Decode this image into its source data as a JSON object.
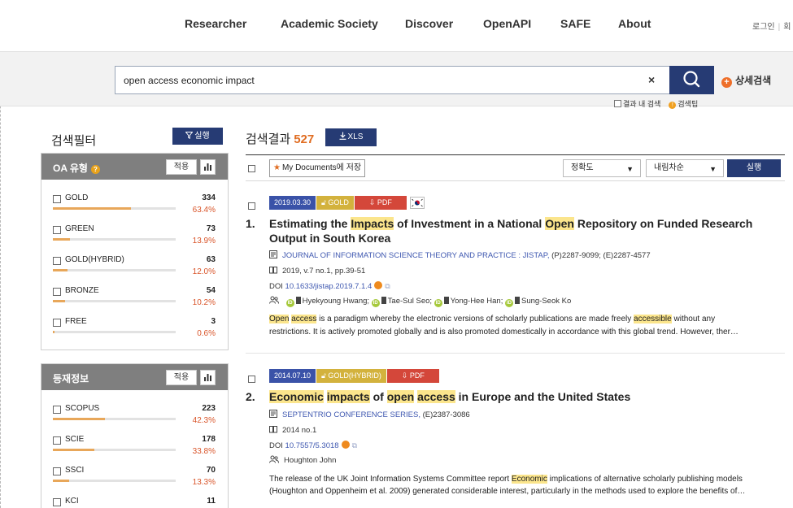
{
  "nav": {
    "items": [
      "Researcher",
      "Academic Society",
      "Discover",
      "OpenAPI",
      "SAFE",
      "About"
    ],
    "login": "로그인",
    "login_sep": "|",
    "login_next": "회"
  },
  "search": {
    "query": "open access economic impact",
    "clear": "×",
    "advanced": "상세검색",
    "within_results": "결과 내 검색",
    "search_tips": "검색팁"
  },
  "filter": {
    "title": "검색필터",
    "run": "실행",
    "apply": "적용",
    "oa_panel": {
      "title": "OA 유형",
      "help": "?",
      "rows": [
        {
          "label": "GOLD",
          "count": "334",
          "pct": "63.4%",
          "fraction": 0.634
        },
        {
          "label": "GREEN",
          "count": "73",
          "pct": "13.9%",
          "fraction": 0.139
        },
        {
          "label": "GOLD(HYBRID)",
          "count": "63",
          "pct": "12.0%",
          "fraction": 0.12
        },
        {
          "label": "BRONZE",
          "count": "54",
          "pct": "10.2%",
          "fraction": 0.102
        },
        {
          "label": "FREE",
          "count": "3",
          "pct": "0.6%",
          "fraction": 0.006
        }
      ]
    },
    "index_panel": {
      "title": "등재정보",
      "rows": [
        {
          "label": "SCOPUS",
          "count": "223",
          "pct": "42.3%",
          "fraction": 0.423
        },
        {
          "label": "SCIE",
          "count": "178",
          "pct": "33.8%",
          "fraction": 0.338
        },
        {
          "label": "SSCI",
          "count": "70",
          "pct": "13.3%",
          "fraction": 0.133
        },
        {
          "label": "KCI",
          "count": "11",
          "pct": "",
          "fraction": 0
        }
      ]
    }
  },
  "results": {
    "title": "검색결과",
    "count": "527",
    "xls": "XLS",
    "save_label": "My Documents에 저장",
    "sort_value": "정확도",
    "order_value": "내림차순",
    "exec": "실행",
    "items": [
      {
        "no": "1.",
        "date": "2019.03.30",
        "oa": "GOLD",
        "pdf": "PDF",
        "title_parts": [
          {
            "t": "Estimating the ",
            "hl": false
          },
          {
            "t": "Impacts",
            "hl": true
          },
          {
            "t": " of Investment in a National ",
            "hl": false
          },
          {
            "t": "Open",
            "hl": true
          },
          {
            "t": " Repository on Funded Research Output in South Korea",
            "hl": false
          }
        ],
        "journal": "JOURNAL OF INFORMATION SCIENCE THEORY AND PRACTICE : JISTAP,",
        "issn": "(P)2287-9099; (E)2287-4577",
        "volume": "2019, v.7 no.1, pp.39-51",
        "doi_label": "DOI",
        "doi": "10.1633/jistap.2019.7.1.4",
        "authors": [
          "Hyekyoung Hwang;",
          "Tae-Sul Seo;",
          "Yong-Hee Han;",
          "Sung-Seok Ko"
        ],
        "abstract_1_parts": [
          {
            "t": "Open",
            "hl": true
          },
          {
            "t": " ",
            "hl": false
          },
          {
            "t": "access",
            "hl": true
          },
          {
            "t": " is a paradigm whereby the electronic versions of scholarly publications are made freely ",
            "hl": false
          },
          {
            "t": "accessible",
            "hl": true
          },
          {
            "t": " without any",
            "hl": false
          }
        ],
        "abstract_2": "restrictions. It is actively promoted globally and is also promoted domestically in accordance with this global trend. However, ther…"
      },
      {
        "no": "2.",
        "date": "2014.07.10",
        "oa": "GOLD(HYBRID)",
        "pdf": "PDF",
        "title_parts": [
          {
            "t": "Economic",
            "hl": true
          },
          {
            "t": " ",
            "hl": false
          },
          {
            "t": "impacts",
            "hl": true
          },
          {
            "t": " of ",
            "hl": false
          },
          {
            "t": "open",
            "hl": true
          },
          {
            "t": " ",
            "hl": false
          },
          {
            "t": "access",
            "hl": true
          },
          {
            "t": " in Europe and the United States",
            "hl": false
          }
        ],
        "journal": "SEPTENTRIO CONFERENCE SERIES,",
        "issn": "(E)2387-3086",
        "volume": "2014 no.1",
        "doi_label": "DOI",
        "doi": "10.7557/5.3018",
        "authors": [
          "Houghton John"
        ],
        "abstract_1_parts": [
          {
            "t": "The release of the UK Joint Information Systems Committee report ",
            "hl": false
          },
          {
            "t": "Economic",
            "hl": true
          },
          {
            "t": " implications of alternative scholarly publishing models",
            "hl": false
          }
        ],
        "abstract_2": "(Houghton and Oppenheim et al. 2009) generated considerable interest, particularly in the methods used to explore the benefits of…"
      }
    ]
  },
  "colors": {
    "navy": "#263b74",
    "orange": "#e06d22",
    "highlight": "#fbe58c",
    "gold_badge": "#d3b23d",
    "pdf_badge": "#d4473a",
    "date_badge": "#3a52a8",
    "link": "#3f58b0"
  }
}
